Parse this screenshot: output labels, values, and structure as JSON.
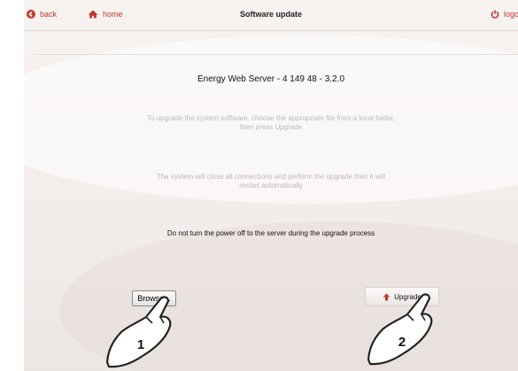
{
  "header": {
    "back_label": "back",
    "home_label": "home",
    "title": "Software update",
    "logout_label": "logo"
  },
  "main": {
    "server_name": "Energy Web Server - 4 149 48 - 3.2.0",
    "instructions_line1": "To upgrade the system software, choose the appropriate file from a local folder,",
    "instructions_line2": "then press Upgrade",
    "notice_line1": "The system will close all connections and perform the upgrade then it will",
    "notice_line2": "restart automatically",
    "warning": "Do not turn the power off to the server during the upgrade process",
    "browse_label": "Browse...",
    "upgrade_label": "Upgrade"
  },
  "callouts": [
    {
      "number": "1"
    },
    {
      "number": "2"
    }
  ],
  "colors": {
    "accent": "#c0392b",
    "callout_fill": "#ffffff",
    "callout_stroke": "#222222"
  },
  "icons": {
    "back": "back-circle-icon",
    "home": "home-icon",
    "logout": "power-icon",
    "upgrade": "up-arrow-icon"
  }
}
